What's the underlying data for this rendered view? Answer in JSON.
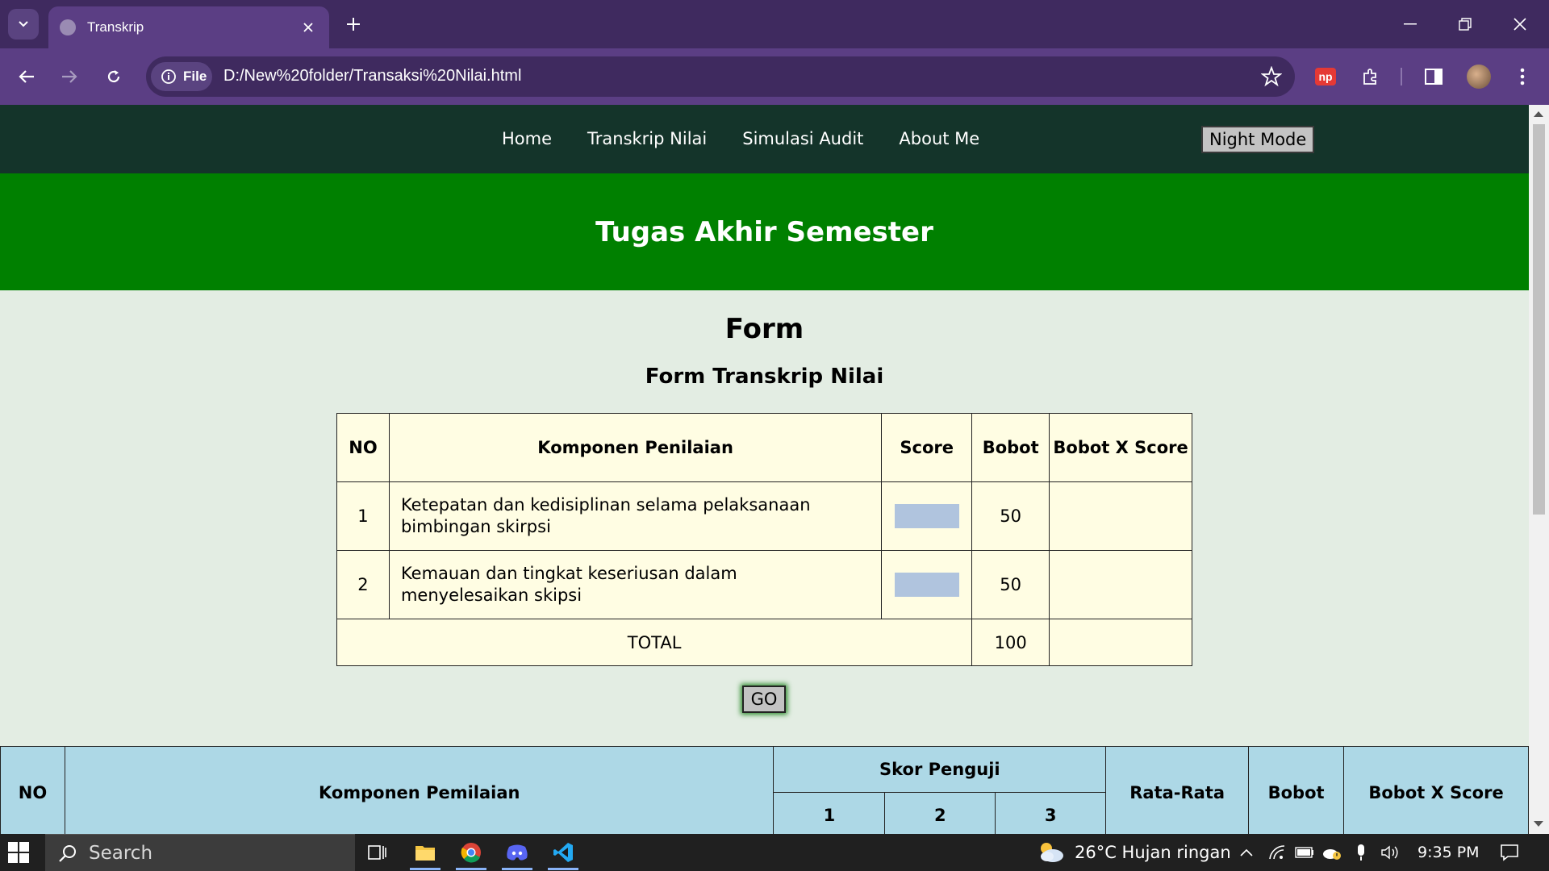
{
  "browser": {
    "tab_title": "Transkrip",
    "scheme_chip": "File",
    "url": "D:/New%20folder/Transaksi%20Nilai.html"
  },
  "nav": {
    "links": [
      "Home",
      "Transkrip Nilai",
      "Simulasi Audit",
      "About Me"
    ],
    "night_mode_label": "Night Mode"
  },
  "hero": {
    "title": "Tugas Akhir Semester"
  },
  "form": {
    "title": "Form",
    "subtitle": "Form Transkrip Nilai",
    "headers": [
      "NO",
      "Komponen Penilaian",
      "Score",
      "Bobot",
      "Bobot X Score"
    ],
    "rows": [
      {
        "no": "1",
        "komponen": "Ketepatan dan kedisiplinan selama pelaksanaan bimbingan skirpsi",
        "bobot": "50"
      },
      {
        "no": "2",
        "komponen": "Kemauan dan tingkat keseriusan dalam menyelesaikan skipsi",
        "bobot": "50"
      }
    ],
    "total_label": "TOTAL",
    "total_bobot": "100",
    "go_label": "GO"
  },
  "table2": {
    "h_no": "NO",
    "h_komponen": "Komponen Pemilaian",
    "h_skor": "Skor Penguji",
    "h_skor_cols": [
      "1",
      "2",
      "3"
    ],
    "h_rata": "Rata-Rata",
    "h_bobot": "Bobot",
    "h_bxs": "Bobot X Score"
  },
  "taskbar": {
    "search_placeholder": "Search",
    "weather": "26°C  Hujan ringan",
    "time": "9:35 PM"
  },
  "colors": {
    "tabbar": "#3f2a5f",
    "toolbar": "#5b3e84",
    "nav": "#14342a",
    "hero": "#008000",
    "page_bg": "#e3ede3",
    "table1_bg": "#fffde3",
    "table2_bg": "#add8e6",
    "score_input": "#b0c4de"
  }
}
